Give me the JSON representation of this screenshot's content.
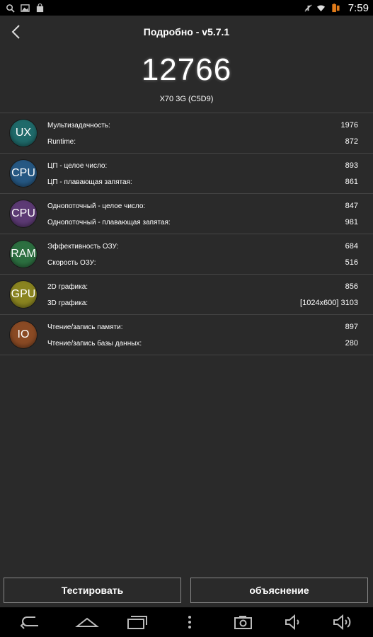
{
  "status_bar": {
    "time": "7:59",
    "left_icons": [
      "search-icon",
      "image-icon",
      "store-icon"
    ],
    "right_icons": [
      "mute-icon",
      "wifi-icon",
      "battery-icon"
    ]
  },
  "header": {
    "title": "Подробно - v5.7.1"
  },
  "score": "12766",
  "device": "X70 3G (C5D9)",
  "groups": [
    {
      "badge": "UX",
      "color": "#1f6a6a",
      "rows": [
        {
          "label": "Мультизадачность:",
          "value": "1976"
        },
        {
          "label": "Runtime:",
          "value": "872"
        }
      ]
    },
    {
      "badge": "CPU",
      "color": "#265883",
      "rows": [
        {
          "label": "ЦП - целое число:",
          "value": "893"
        },
        {
          "label": "ЦП - плавающая запятая:",
          "value": "861"
        }
      ]
    },
    {
      "badge": "CPU",
      "color": "#5c3a74",
      "rows": [
        {
          "label": "Однопоточный - целое число:",
          "value": "847"
        },
        {
          "label": "Однопоточный - плавающая запятая:",
          "value": "981"
        }
      ]
    },
    {
      "badge": "RAM",
      "color": "#2c6f40",
      "rows": [
        {
          "label": "Эффективность ОЗУ:",
          "value": "684"
        },
        {
          "label": "Скорость ОЗУ:",
          "value": "516"
        }
      ]
    },
    {
      "badge": "GPU",
      "color": "#8a8420",
      "rows": [
        {
          "label": "2D графика:",
          "value": "856"
        },
        {
          "label": "3D графика:",
          "value": "[1024x600] 3103"
        }
      ]
    },
    {
      "badge": "IO",
      "color": "#8a4a24",
      "rows": [
        {
          "label": "Чтение/запись памяти:",
          "value": "897"
        },
        {
          "label": "Чтение/запись базы данных:",
          "value": "280"
        }
      ]
    }
  ],
  "buttons": {
    "test": "Тестировать",
    "explain": "объяснение"
  },
  "nav_icons": [
    "back-icon",
    "home-icon",
    "recents-icon",
    "menu-icon",
    "screenshot-icon",
    "volume-down-icon",
    "volume-up-icon"
  ]
}
